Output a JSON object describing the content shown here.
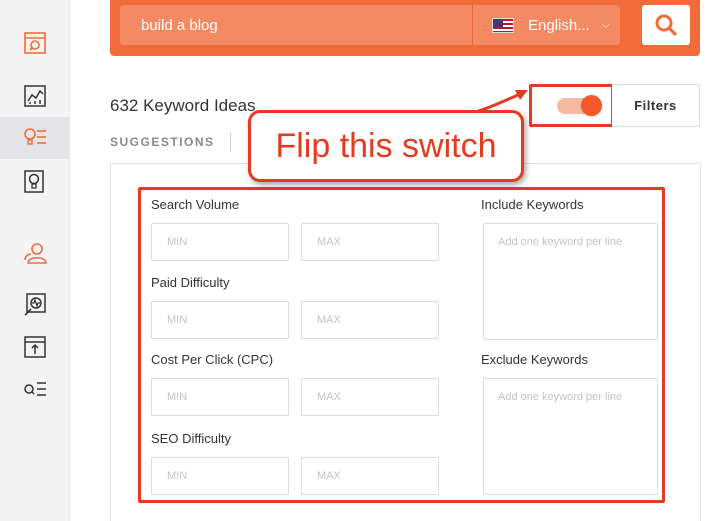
{
  "sidebar": {
    "items": [
      {
        "icon": "browser-search-icon",
        "active": false
      },
      {
        "icon": "chart-icon",
        "active": false
      },
      {
        "icon": "keyword-ideas-icon",
        "active": true
      },
      {
        "icon": "content-ideas-icon",
        "active": false
      },
      {
        "icon": "users-icon",
        "active": false
      },
      {
        "icon": "site-audit-icon",
        "active": false
      },
      {
        "icon": "rank-tracking-icon",
        "active": false
      },
      {
        "icon": "search-list-icon",
        "active": false
      }
    ]
  },
  "search": {
    "value": "build a blog",
    "language": "English...",
    "flag": "us-flag-icon"
  },
  "results": {
    "headline": "632 Keyword Ideas",
    "filters_label": "Filters",
    "toggle_on": true,
    "tab_suggestions": "SUGGESTIONS"
  },
  "filters": {
    "search_volume": {
      "label": "Search Volume",
      "min": "MIN",
      "max": "MAX"
    },
    "paid_difficulty": {
      "label": "Paid Difficulty",
      "min": "MIN",
      "max": "MAX"
    },
    "cpc": {
      "label": "Cost Per Click (CPC)",
      "min": "MIN",
      "max": "MAX"
    },
    "seo_difficulty": {
      "label": "SEO Difficulty",
      "min": "MIN",
      "max": "MAX"
    },
    "include_keywords": {
      "label": "Include Keywords",
      "placeholder": "Add one keyword per line"
    },
    "exclude_keywords": {
      "label": "Exclude Keywords",
      "placeholder": "Add one keyword per line"
    }
  },
  "annotation": {
    "callout_text": "Flip this switch"
  },
  "colors": {
    "accent": "#f26b3a",
    "annotation_red": "#e43a1f"
  }
}
